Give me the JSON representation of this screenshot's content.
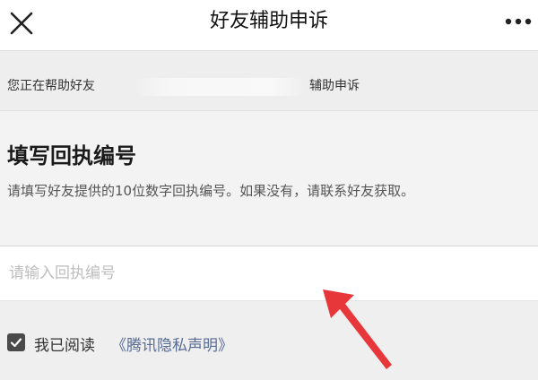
{
  "nav": {
    "title": "好友辅助申诉",
    "close_icon": "close-icon",
    "more_icon": "more-icon"
  },
  "helper": {
    "prefix": "您正在帮助好友",
    "suffix": "辅助申诉"
  },
  "section": {
    "heading": "填写回执编号",
    "description": "请填写好友提供的10位数字回执编号。如果没有，请联系好友获取。"
  },
  "receipt_input": {
    "placeholder": "请输入回执编号",
    "value": ""
  },
  "agreement": {
    "checked": true,
    "label": "我已阅读",
    "link_text": "《腾讯隐私声明》"
  },
  "colors": {
    "link": "#576b95",
    "arrow": "#e8373a"
  }
}
